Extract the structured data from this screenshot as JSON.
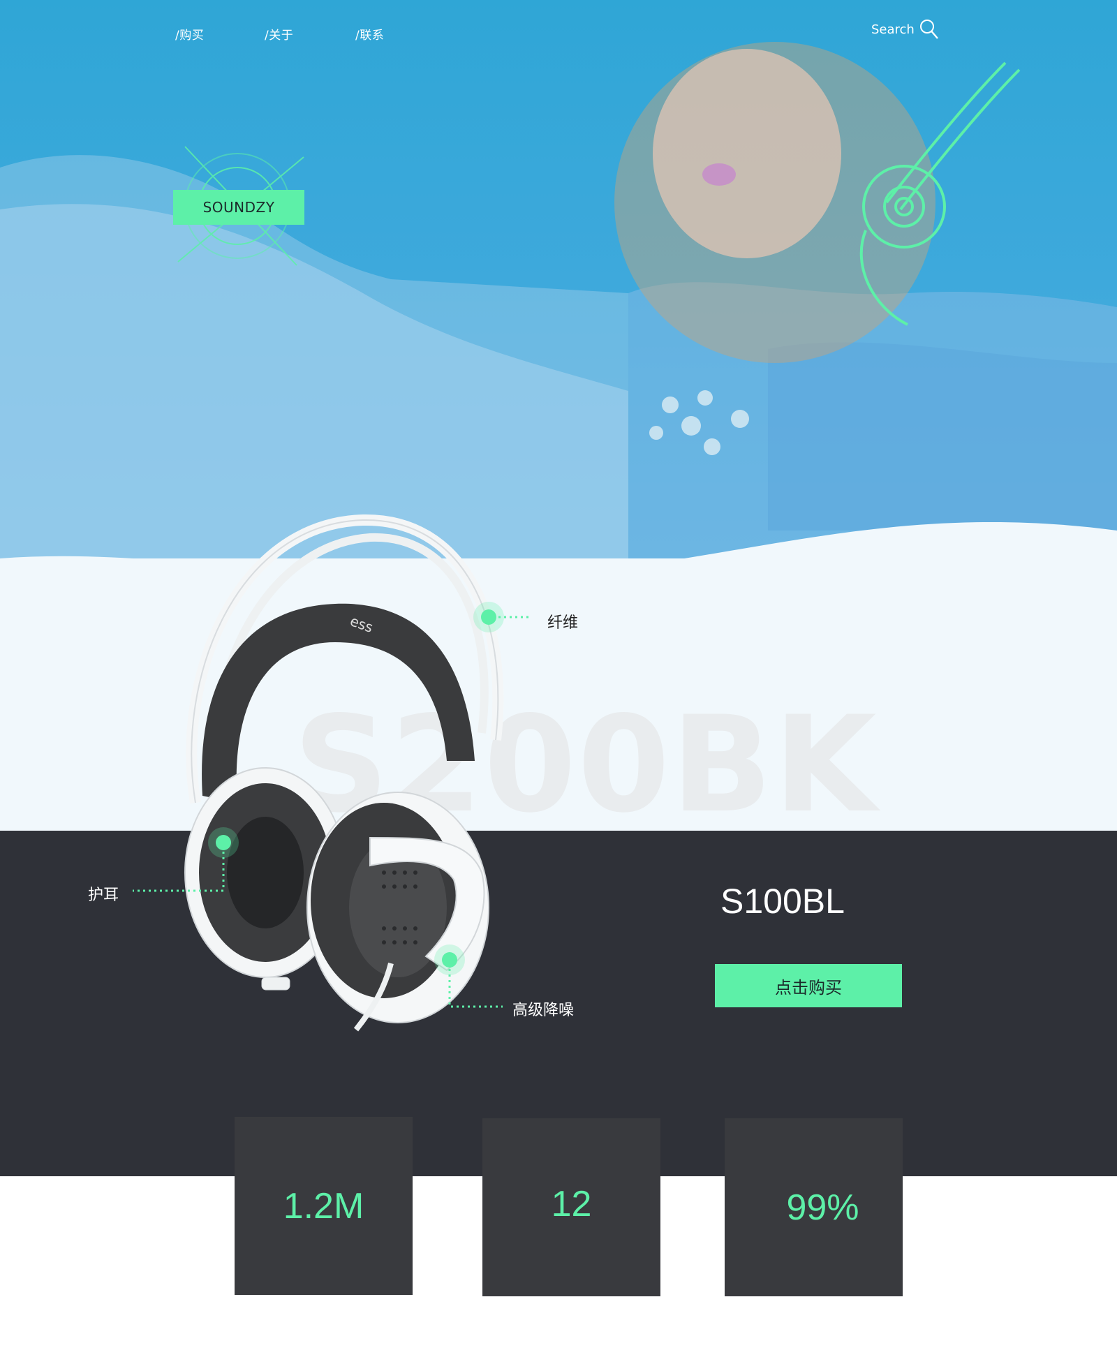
{
  "nav": {
    "items": [
      {
        "label": "/购买"
      },
      {
        "label": "/关于"
      },
      {
        "label": "/联系"
      }
    ],
    "search_label": "Search"
  },
  "hero": {
    "brand": "SOUNDZY",
    "accent_color": "#5df0a8"
  },
  "product": {
    "watermark": "S200BK",
    "model": "S100BL",
    "buy_label": "点击购买",
    "features": {
      "fiber": "纤维",
      "earpad": "护耳",
      "noise": "高级降噪"
    }
  },
  "stats": [
    {
      "value": "1.2M"
    },
    {
      "value": "12"
    },
    {
      "value": "99%"
    }
  ],
  "colors": {
    "hero_blue": "#3ea9dc",
    "dark": "#2f3138",
    "stat_box": "#393a3e",
    "accent": "#5df0a8"
  }
}
